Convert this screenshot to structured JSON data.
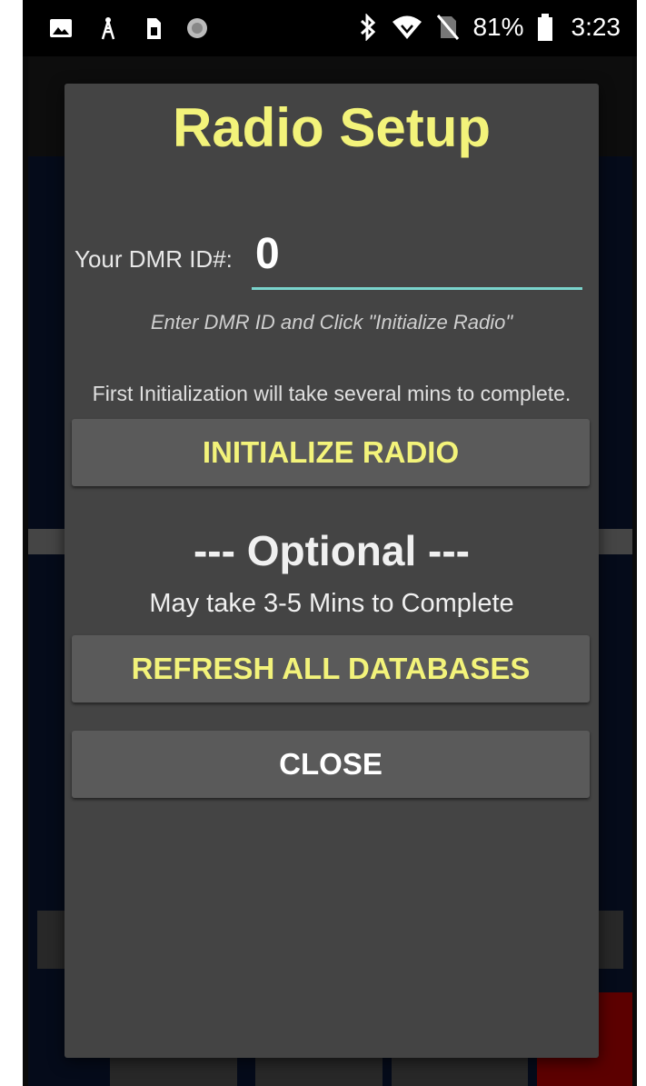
{
  "status_bar": {
    "left_icons": [
      "image-icon",
      "tower-icon",
      "sim-card-icon",
      "circle-icon"
    ],
    "battery": "81%",
    "time": "3:23",
    "right_icons": [
      "bluetooth-icon",
      "wifi-icon",
      "no-sim-icon",
      "battery-icon"
    ]
  },
  "dialog": {
    "title": "Radio Setup",
    "dmr_label": "Your DMR ID#:",
    "dmr_value": "0",
    "hint": "Enter DMR ID and Click \"Initialize Radio\"",
    "init_note": "First Initialization will take several mins to complete.",
    "init_button": "INITIALIZE RADIO",
    "optional_title": "--- Optional ---",
    "optional_sub": "May take 3-5 Mins to Complete",
    "refresh_button": "REFRESH ALL DATABASES",
    "close_button": "CLOSE"
  },
  "colors": {
    "accent_yellow": "#f3f37a",
    "input_underline": "#7ad3cc",
    "dialog_bg": "#444444",
    "button_bg": "#5a5a5a"
  }
}
